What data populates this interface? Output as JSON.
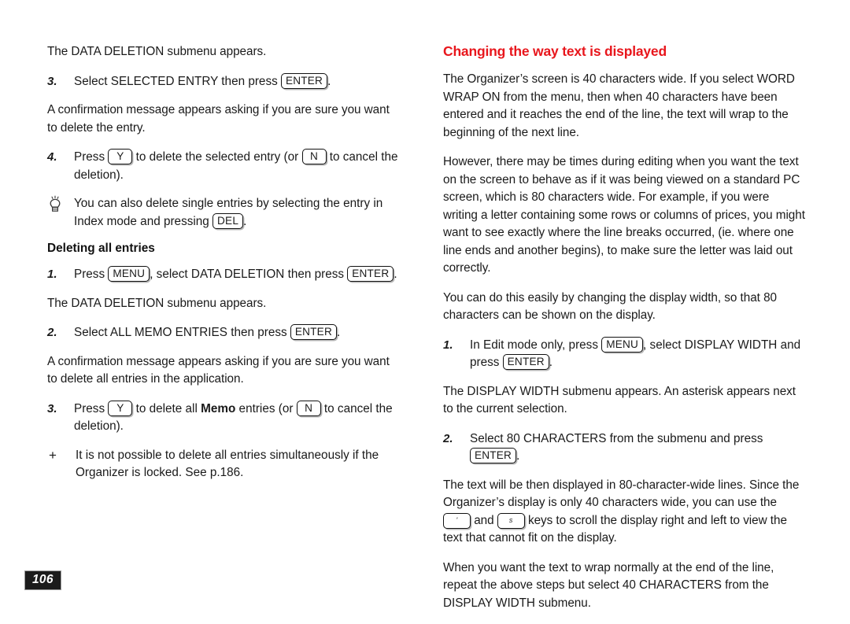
{
  "document": {
    "page_number": "106",
    "accent_color": "#E8161C",
    "text_color": "#1a1a1a",
    "badge_background": "#1c1c1c",
    "badge_text_color": "#ffffff"
  },
  "left_column": {
    "intro_paragraph": "The DATA DELETION submenu appears.",
    "step_3": {
      "marker": "3.",
      "text_before_key": "Select SELECTED ENTRY then press ",
      "key": "ENTER",
      "text_after_key": "."
    },
    "confirmation_paragraph": "A confirmation message appears asking if you are sure you want to delete the entry.",
    "step_4": {
      "marker": "4.",
      "text_1": "Press ",
      "key_1": "Y",
      "text_2": " to delete the selected entry (or ",
      "key_2": "N",
      "text_3": " to cancel the deletion)."
    },
    "tip": {
      "marker_icon": "lightbulb-icon",
      "text_1": "You can also delete single entries by selecting the entry in Index mode and pressing ",
      "key": "DEL",
      "text_2": "."
    },
    "subheading": "Deleting all entries",
    "all_step_1": {
      "marker": "1.",
      "text_1": "Press ",
      "key_1": "MENU",
      "text_2": ", select DATA DELETION then press ",
      "key_2": "ENTER",
      "text_3": "."
    },
    "submenu_paragraph": "The DATA DELETION submenu appears.",
    "all_step_2": {
      "marker": "2.",
      "text_1": "Select ALL MEMO ENTRIES then press ",
      "key_1": "ENTER",
      "text_2": "."
    },
    "confirmation_all_paragraph": "A confirmation message appears asking if you are sure you want to delete all entries in the application.",
    "all_step_3": {
      "marker": "3.",
      "text_1": "Press ",
      "key_1": "Y",
      "text_2": " to delete all ",
      "bold_word": "Memo",
      "text_3": " entries (or ",
      "key_2": "N",
      "text_4": " to cancel the deletion)."
    },
    "note": {
      "marker": "+",
      "text": "It is not possible to delete all entries simultaneously if the Organizer is locked. See p.186."
    }
  },
  "right_column": {
    "heading": "Changing the way text is displayed",
    "paragraph_1": "The Organizer’s screen is 40 characters wide. If you select WORD WRAP ON from the menu, then when 40 characters have been entered and it reaches the end of the line, the text will wrap to the beginning of the next line.",
    "paragraph_2": "However, there may be times during editing when you want the text on the screen to behave as if it was being viewed on a standard PC screen, which is 80 characters wide. For example, if you were writing a letter containing some rows or columns of prices, you might want to see exactly where the line breaks occurred, (ie. where one line ends and another begins), to make sure the letter was laid out correctly.",
    "paragraph_3": "You can do this easily by changing the display width, so that 80 characters can be shown on the display.",
    "step_1": {
      "marker": "1.",
      "text_1": "In Edit mode only, press ",
      "key_1": "MENU",
      "text_2": ", select DISPLAY WIDTH and press ",
      "key_2": "ENTER",
      "text_3": "."
    },
    "submenu_paragraph": "The DISPLAY WIDTH submenu appears. An asterisk appears next to the current selection.",
    "step_2": {
      "marker": "2.",
      "text_1": "Select 80 CHARACTERS from the submenu and press ",
      "key_1": "ENTER",
      "text_2": "."
    },
    "paragraph_4": {
      "text_1": "The text will be then displayed in 80-character-wide lines. Since the Organizer’s display is only 40 characters wide, you can use the ",
      "key_1": "'",
      "text_2": " and ",
      "key_2": "s",
      "text_3": " keys to scroll the display right and left to view the text that cannot fit on the display."
    },
    "paragraph_5": "When you want the text to wrap normally at the end of the line, repeat the above steps but select 40 CHARACTERS from the DISPLAY WIDTH submenu."
  }
}
